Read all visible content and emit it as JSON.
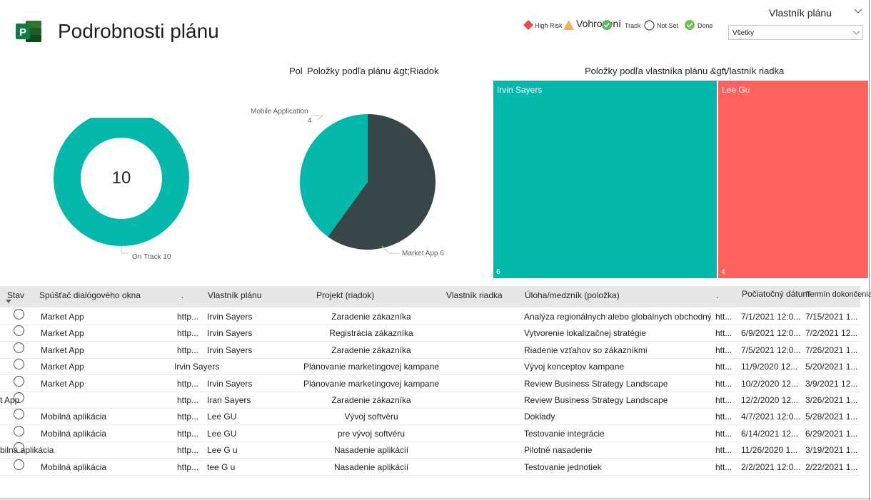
{
  "page": {
    "title": "Podrobnosti plánu",
    "logo_icon": "project-logo-icon"
  },
  "legend": {
    "title": "Vohrození",
    "items": [
      {
        "label": "High Risk",
        "color": "#e8494a",
        "icon": "diamond-icon"
      },
      {
        "label": "",
        "color": "#f2b15a",
        "icon": "triangle-icon"
      },
      {
        "label": "Track",
        "color": "#5cb85c",
        "icon": "check-circle-icon"
      },
      {
        "label": "Not Set",
        "color": "#ffffff",
        "icon": "empty-circle-icon"
      },
      {
        "label": "Done",
        "color": "#6cc24a",
        "icon": "check-circle-icon"
      }
    ]
  },
  "slicer": {
    "title": "Vlastník plánu",
    "value": "Všetky"
  },
  "donut": {
    "center_value": "10",
    "label": "On Track 10",
    "color": "#01b8aa"
  },
  "pie": {
    "title_overlap": "Pol",
    "title": "Položky podľa plánu &gt;",
    "title_suffix": "Riadok",
    "labels": {
      "mobile_name": "Mobile Application",
      "mobile_value": "4",
      "market": "Market App 6"
    }
  },
  "treemap": {
    "title": "Položky podľa vlastníka plánu &gt;",
    "title_suffix": "Vlastník riadka"
  },
  "chart_data": [
    {
      "type": "pie",
      "variant": "donut",
      "categories": [
        "On Track"
      ],
      "values": [
        10
      ],
      "colors": [
        "#01b8aa"
      ]
    },
    {
      "type": "pie",
      "categories": [
        "Market App",
        "Mobile Application"
      ],
      "values": [
        6,
        4
      ],
      "colors": [
        "#374649",
        "#01b8aa"
      ]
    },
    {
      "type": "treemap",
      "categories": [
        "Irvin Sayers",
        "Lee Gu"
      ],
      "values": [
        6,
        4
      ],
      "colors": [
        "#01b8aa",
        "#fd625e"
      ]
    }
  ],
  "table": {
    "headers": {
      "stav": "Stav",
      "launcher": "Spúšťač dialógového okna",
      "dot1": ".",
      "owner": "Vlastník plánu",
      "project": "Projekt (riadok)",
      "row_owner": "Vlastník riadka",
      "task": "Úloha/medzník (položka)",
      "dot2": ".",
      "start": "Počiatočný dátum",
      "end": "Termín dokončenia"
    },
    "rows": [
      {
        "launcher": "Market App",
        "link": "http...",
        "owner": "Irvin Sayers",
        "project": "Zaradenie zákazníka",
        "task": "Analýza regionálnych alebo globálnych obchodných modelov krajín",
        "link2": "htt...",
        "start": "7/1/2021 12:0...",
        "end": "7/15/2021 1..."
      },
      {
        "launcher": "Market App",
        "link": "http...",
        "owner": "Irvin Sayers",
        "project": "Registrácia zákazníka",
        "task": "Vytvorenie lokalizačnej stratégie",
        "link2": "htt...",
        "start": "6/9/2021 12:0...",
        "end": "7/2/2021 12..."
      },
      {
        "launcher": "Market App",
        "link": "http...",
        "owner": "Irvin Sayers",
        "project": "Zaradenie zákazníka",
        "task": "Riadenie vzťahov so zákazníkmi",
        "link2": "htt...",
        "start": "7/5/2021 12:0...",
        "end": "7/26/2021 1..."
      },
      {
        "launcher": "Market App",
        "link": "Irvin Sayers",
        "owner": "",
        "project": "Plánovanie marketingovej kampane",
        "task": "Vývoj konceptov kampane",
        "link2": "htt...",
        "start": "11/9/2020 12...",
        "end": "5/20/2021 1..."
      },
      {
        "launcher": "Market App",
        "link": "http...",
        "owner": "Irvin Sayers",
        "project": "Plánovanie marketingovej kampane",
        "task": "Review Business Strategy Landscape",
        "link2": "htt...",
        "start": "10/2/2020 12...",
        "end": "3/9/2021 12..."
      },
      {
        "launcher": "t App",
        "link": "http...",
        "owner": "Iran Sayers",
        "project": "Zaradenie zákazníka",
        "task": "Review Business Strategy Landscape",
        "link2": "htt...",
        "start": "12/2/2020 12...",
        "end": "3/26/2021 1..."
      },
      {
        "launcher": "Mobilná aplikácia",
        "link": "http...",
        "owner": "Lee GU",
        "project": "Vývoj softvéru",
        "task": "Doklady",
        "link2": "htt...",
        "start": "4/7/2021 12:0...",
        "end": "5/28/2021 1..."
      },
      {
        "launcher": "Mobilná aplikácia",
        "link": "http...",
        "owner": "Lee GU",
        "project": "pre vývoj softvéru",
        "task": "Testovanie integrácie",
        "link2": "htt...",
        "start": "6/14/2021 12...",
        "end": "6/29/2021 1..."
      },
      {
        "launcher": "bilná aplikácia",
        "link": "http...",
        "owner": "Lee G u",
        "project": "Nasadenie aplikácií",
        "task": "Pilotné nasadenie",
        "link2": "htt...",
        "start": "11/26/2020 1...",
        "end": "3/19/2021 1..."
      },
      {
        "launcher": "Mobilná aplikácia",
        "link": "http...",
        "owner": "tee G u",
        "project": "Nasadenie aplikácií",
        "task": "Testovanie jednotiek",
        "link2": "htt...",
        "start": "2/2/2021 12:0...",
        "end": "2/22/2021 1..."
      }
    ]
  }
}
